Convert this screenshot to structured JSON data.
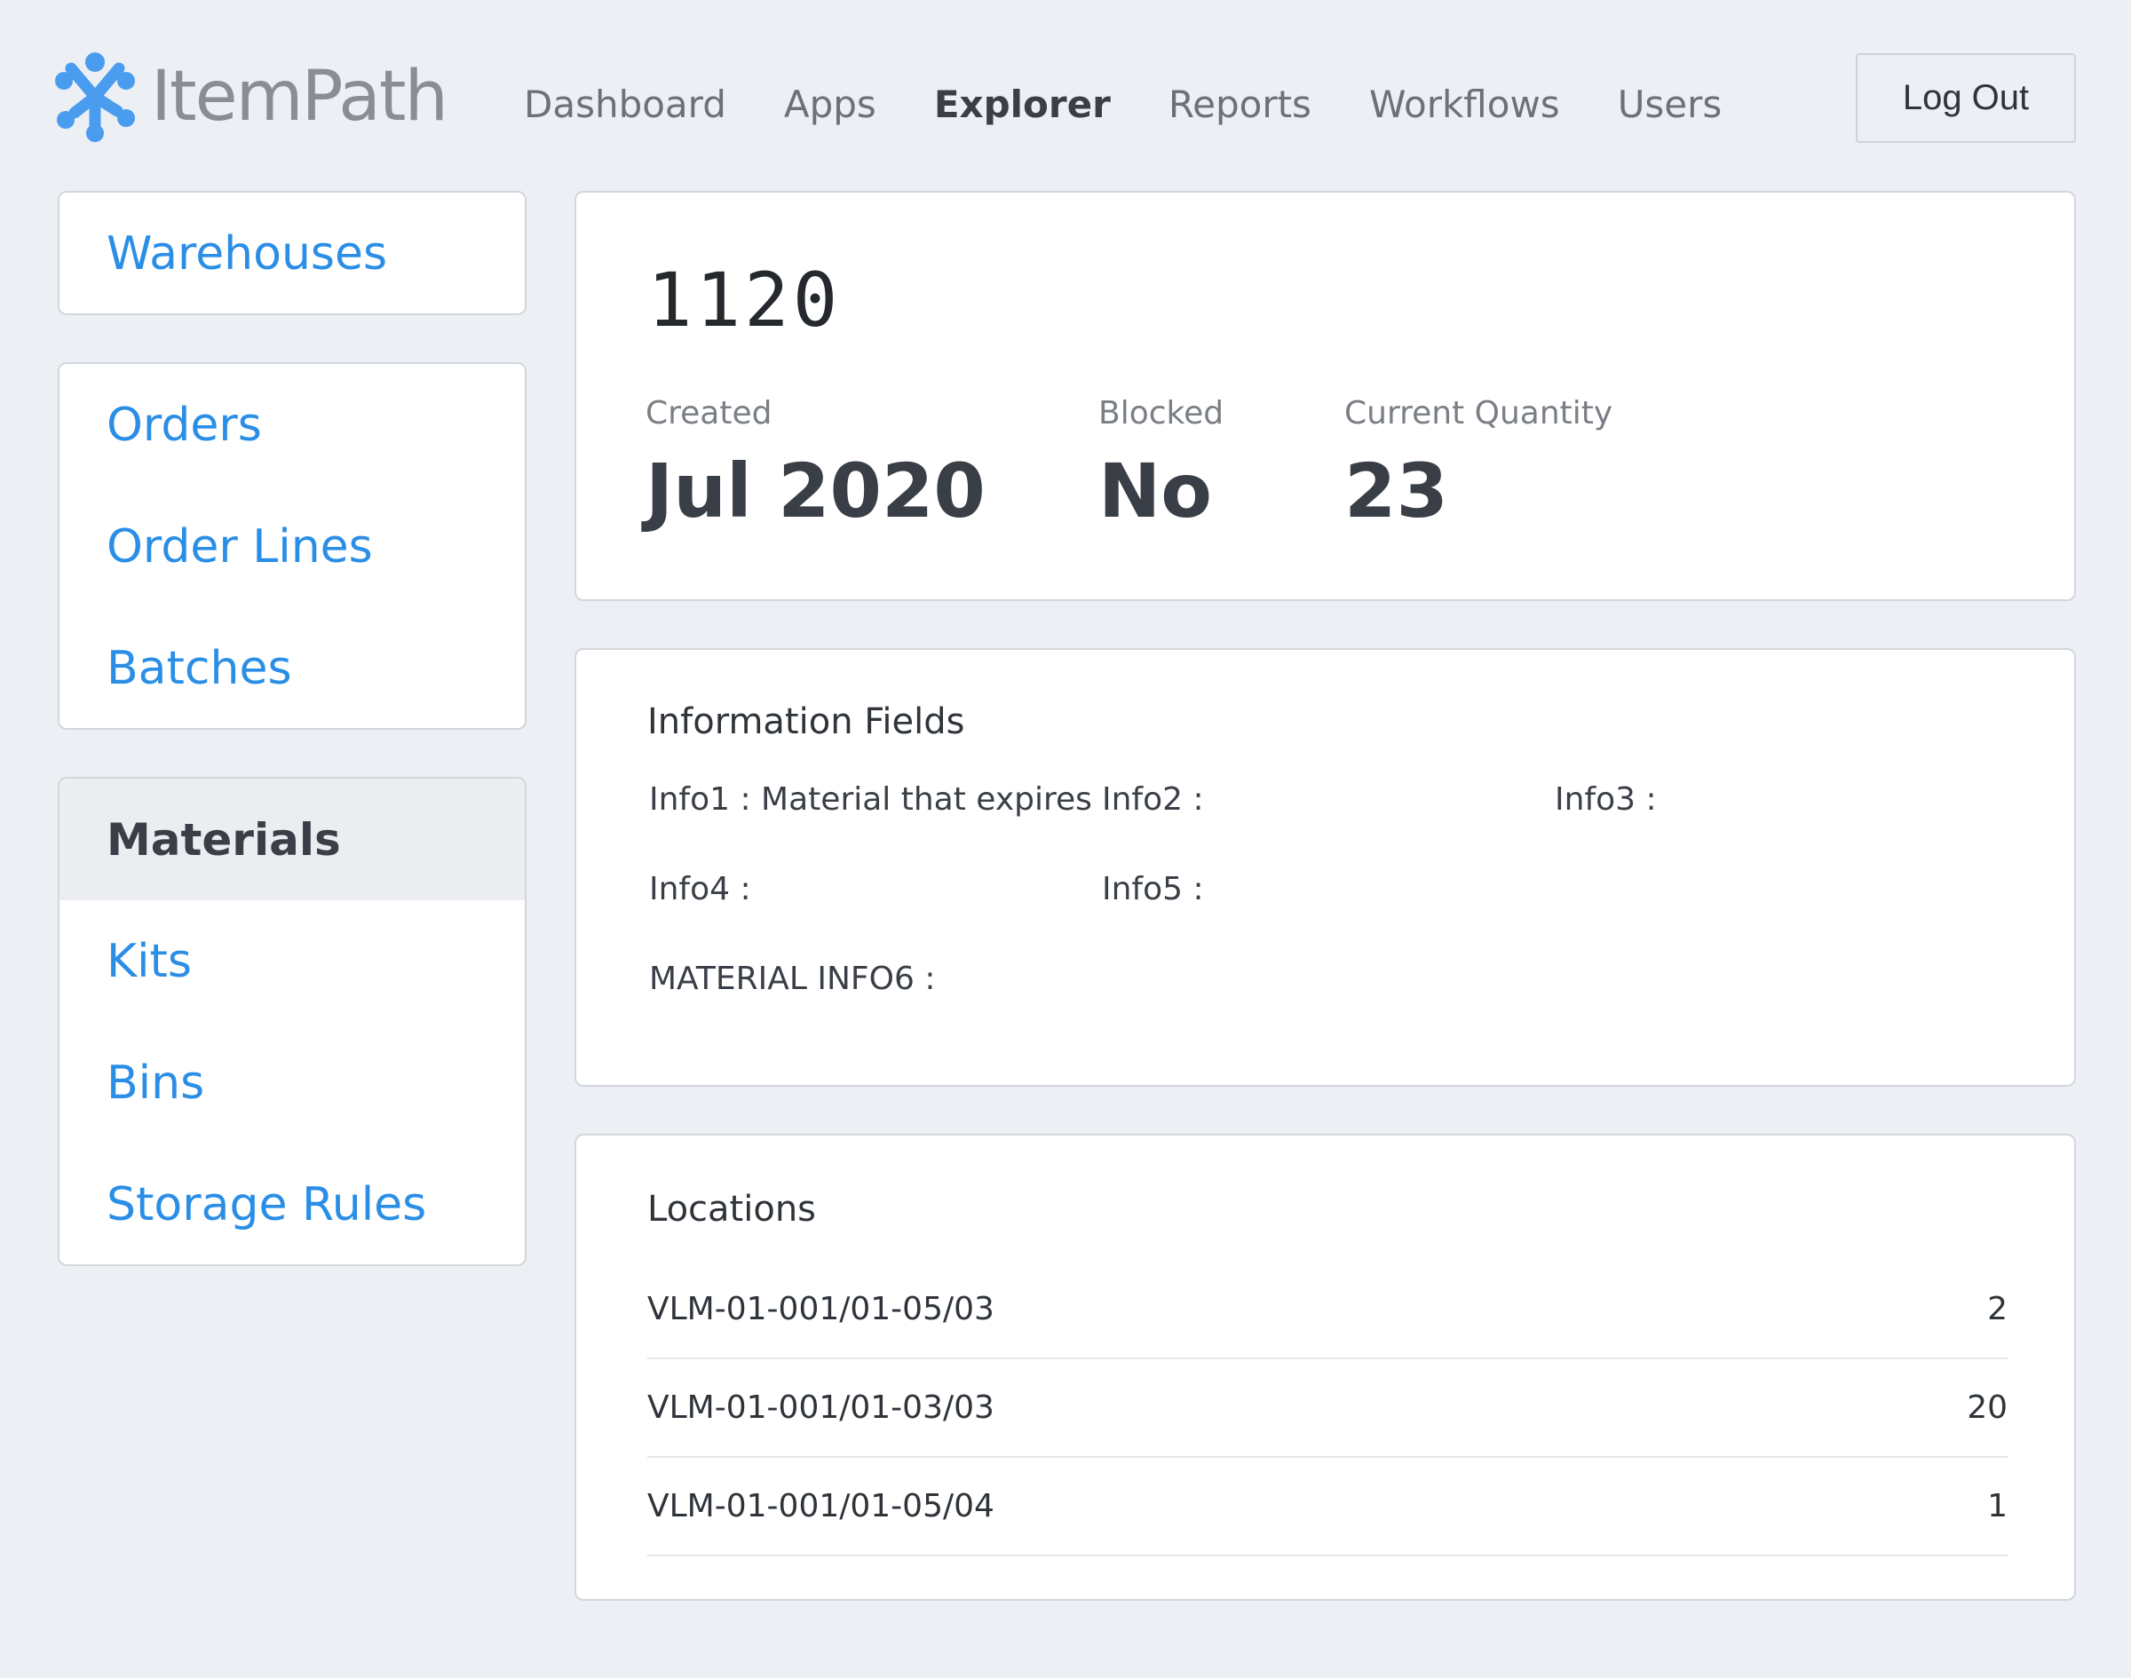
{
  "header": {
    "logo_text": "ItemPath",
    "nav": [
      {
        "label": "Dashboard",
        "active": false
      },
      {
        "label": "Apps",
        "active": false
      },
      {
        "label": "Explorer",
        "active": true
      },
      {
        "label": "Reports",
        "active": false
      },
      {
        "label": "Workflows",
        "active": false
      },
      {
        "label": "Users",
        "active": false
      }
    ],
    "logout_label": "Log Out"
  },
  "sidebar": {
    "group1": [
      {
        "label": "Warehouses"
      }
    ],
    "group2": [
      {
        "label": "Orders"
      },
      {
        "label": "Order Lines"
      },
      {
        "label": "Batches"
      }
    ],
    "group3": [
      {
        "label": "Materials",
        "active": true
      },
      {
        "label": "Kits"
      },
      {
        "label": "Bins"
      },
      {
        "label": "Storage Rules"
      }
    ]
  },
  "material": {
    "id": "1120",
    "stats": [
      {
        "label": "Created",
        "value": "Jul 2020"
      },
      {
        "label": "Blocked",
        "value": "No"
      },
      {
        "label": "Current Quantity",
        "value": "23"
      }
    ]
  },
  "info_fields": {
    "title": "Information Fields",
    "fields": [
      {
        "text": "Info1 :  Material that expires"
      },
      {
        "text": "Info2 :"
      },
      {
        "text": "Info3 :"
      },
      {
        "text": "Info4 :"
      },
      {
        "text": "Info5 :"
      },
      {
        "text": "MATERIAL INFO6 :"
      }
    ]
  },
  "locations": {
    "title": "Locations",
    "rows": [
      {
        "name": "VLM-01-001/01-05/03",
        "qty": "2"
      },
      {
        "name": "VLM-01-001/01-03/03",
        "qty": "20"
      },
      {
        "name": "VLM-01-001/01-05/04",
        "qty": "1"
      }
    ]
  },
  "colors": {
    "background": "#eceff4",
    "link": "#2b8ee6",
    "logo_icon": "#4a9cef",
    "text": "#3a3f47"
  }
}
